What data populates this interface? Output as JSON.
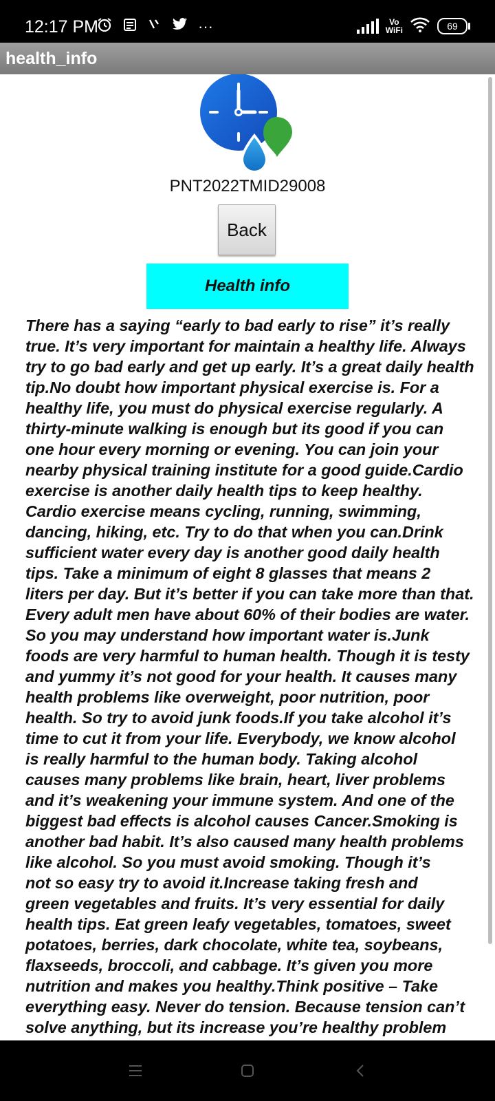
{
  "status_bar": {
    "time": "12:17 PM",
    "network_label": "Vo\nWiFi",
    "battery": "69",
    "more_glyph": "···",
    "icons": [
      "alarm-icon",
      "notes-icon",
      "download-icon",
      "twitter-icon",
      "signal-icon",
      "wifi-icon",
      "battery-icon"
    ]
  },
  "app": {
    "title": "health_info"
  },
  "main": {
    "app_id": "PNT2022TMID29008",
    "back_label": "Back",
    "header": "Health info",
    "body": "There has a saying “early to bad early to rise” it’s really\ntrue. It’s very important for maintain a healthy life. Always\ntry to go bad early and get up early. It’s a great daily health\ntip.No doubt how important physical exercise is. For a\nhealthy life, you must do physical exercise regularly. A\nthirty-minute walking is enough but its good if you can\none hour every morning or evening. You can join your\nnearby physical training institute for a good guide.Cardio\nexercise is another daily health tips to keep healthy.\nCardio exercise means cycling, running, swimming,\ndancing, hiking, etc. Try to do that when you can.Drink\nsufficient water every day is another good daily health\ntips. Take a minimum of eight 8 glasses that means 2\nliters per day. But it’s better if you can take more than that.\nEvery adult men have about 60% of their bodies are water.\nSo you may understand how important water is.Junk\nfoods are very harmful to human health. Though it is testy\nand yummy it’s not good for your health. It causes many\nhealth problems like overweight, poor nutrition, poor\nhealth. So try to avoid junk foods.If you take alcohol it’s\ntime to cut it from your life. Everybody, we know alcohol\nis really harmful to the human body. Taking alcohol\ncauses many problems like brain, heart, liver problems\nand it’s weakening your immune system.  And one of the\nbiggest bad effects is alcohol causes Cancer.Smoking is\nanother bad habit. It’s also caused many health problems\nlike alcohol. So you must avoid smoking. Though it’s\nnot so easy try to avoid it.Increase taking fresh and\ngreen vegetables and fruits. It’s very essential for daily\nhealth tips. Eat green leafy vegetables, tomatoes, sweet\npotatoes, berries, dark chocolate, white tea, soybeans,\nflaxseeds, broccoli, and cabbage. It’s given you more\nnutrition and makes you healthy.Think positive – Take\neverything easy. Never do tension. Because tension can’t\nsolve anything, but its increase you’re healthy problem"
  },
  "nav_bar": {
    "icons": [
      "menu-icon",
      "home-icon",
      "back-icon"
    ]
  },
  "colors": {
    "title_bar": "#8a8a8a",
    "header_box": "#00ffff",
    "logo_blue": "#1565d8",
    "logo_green": "#3aa53a"
  }
}
